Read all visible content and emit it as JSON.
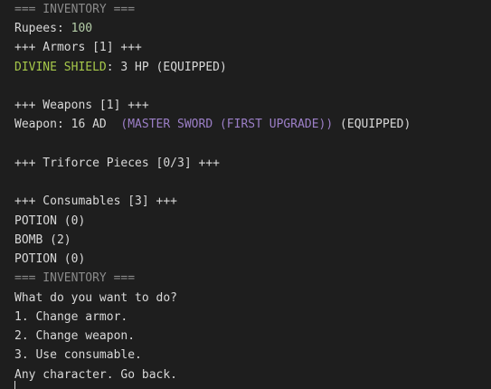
{
  "header_top": "=== INVENTORY ===",
  "rupees": {
    "label": "Rupees: ",
    "value": "100"
  },
  "armors_header": "+++ Armors [1] +++",
  "armor": {
    "name": "DIVINE SHIELD",
    "rest": ": 3 HP (EQUIPPED)"
  },
  "weapons_header": "+++ Weapons [1] +++",
  "weapon": {
    "prefix": "Weapon: 16 AD  ",
    "name": "(MASTER SWORD (FIRST UPGRADE))",
    "suffix": " (EQUIPPED)"
  },
  "triforce_header": "+++ Triforce Pieces [0/3] +++",
  "consumables_header": "+++ Consumables [3] +++",
  "consumables": [
    "POTION (0)",
    "BOMB (2)",
    "POTION (0)"
  ],
  "header_bottom": "=== INVENTORY ===",
  "prompt": "What do you want to do?",
  "options": [
    "1. Change armor.",
    "2. Change weapon.",
    "3. Use consumable."
  ],
  "back_text": "Any character. Go back.",
  "colors": {
    "background": "#1e1e1e",
    "text": "#d8d8d8",
    "dim": "#8a8a8a",
    "number": "#b5cea8",
    "armor_name": "#a6c84a",
    "weapon_name": "#9c7fc7"
  }
}
